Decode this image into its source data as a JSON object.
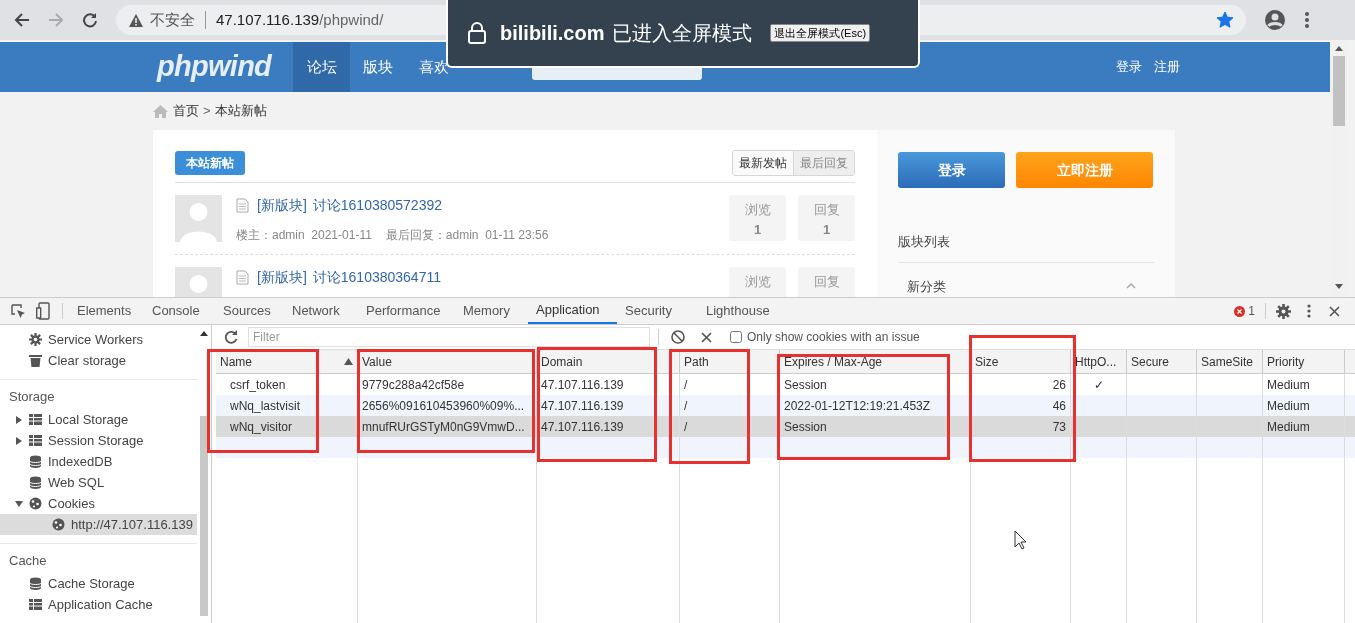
{
  "browser": {
    "security_label": "不安全",
    "url_host": "47.107.116.139",
    "url_path": "/phpwind/",
    "forward_disabled": true,
    "bookmarked": true
  },
  "fullscreen_notice": {
    "site": "bilibili.com",
    "message": "已进入全屏模式",
    "exit_button": "退出全屏模式(Esc)"
  },
  "site": {
    "logo": "phpwind",
    "nav": [
      {
        "label": "论坛",
        "selected": true
      },
      {
        "label": "版块",
        "selected": false
      },
      {
        "label": "喜欢",
        "selected": false
      }
    ],
    "user_links": [
      "登录",
      "注册"
    ],
    "breadcrumb": [
      "首页",
      ">",
      "本站新帖"
    ],
    "list_title": "本站新帖",
    "sort_tabs": [
      {
        "label": "最新发帖",
        "selected": true
      },
      {
        "label": "最后回复",
        "selected": false
      }
    ],
    "posts": [
      {
        "forum": "[新版块]",
        "title": "讨论1610380572392",
        "author": "楼主：admin  2021-01-11",
        "last_reply": "最后回复：admin  01-11 23:56",
        "views_label": "浏览",
        "views": "1",
        "replies_label": "回复",
        "replies": "1"
      },
      {
        "forum": "[新版块]",
        "title": "讨论1610380364711",
        "views_label": "浏览",
        "replies_label": "回复"
      }
    ],
    "login_button": "登录",
    "register_button": "立即注册",
    "forum_list_title": "版块列表",
    "forum_categories": [
      {
        "label": "新分类",
        "expanded": true
      }
    ]
  },
  "devtools": {
    "tabs": [
      {
        "label": "Elements",
        "selected": false
      },
      {
        "label": "Console",
        "selected": false
      },
      {
        "label": "Sources",
        "selected": false
      },
      {
        "label": "Network",
        "selected": false
      },
      {
        "label": "Performance",
        "selected": false
      },
      {
        "label": "Memory",
        "selected": false
      },
      {
        "label": "Application",
        "selected": true
      },
      {
        "label": "Security",
        "selected": false
      },
      {
        "label": "Lighthouse",
        "selected": false
      }
    ],
    "error_count": "1",
    "sidebar": [
      {
        "kind": "item",
        "label": "Service Workers"
      },
      {
        "kind": "item",
        "label": "Clear storage"
      },
      {
        "kind": "header",
        "label": "Storage"
      },
      {
        "kind": "item",
        "label": "Local Storage",
        "expanded": false
      },
      {
        "kind": "item",
        "label": "Session Storage",
        "expanded": false
      },
      {
        "kind": "item",
        "label": "IndexedDB"
      },
      {
        "kind": "item",
        "label": "Web SQL"
      },
      {
        "kind": "item",
        "label": "Cookies",
        "expanded": true,
        "children": [
          {
            "kind": "item",
            "label": "http://47.107.116.139",
            "selected": true
          }
        ]
      },
      {
        "kind": "header",
        "label": "Cache"
      },
      {
        "kind": "item",
        "label": "Cache Storage"
      },
      {
        "kind": "item",
        "label": "Application Cache"
      }
    ],
    "filter": {
      "placeholder": "Filter"
    },
    "only_issues": {
      "label": "Only show cookies with an issue",
      "checked": false
    },
    "columns": [
      "Name",
      "Value",
      "Domain",
      "Path",
      "Expires / Max-Age",
      "Size",
      "HttpO...",
      "Secure",
      "SameSite",
      "Priority"
    ],
    "rows": [
      {
        "selected": false,
        "cells": [
          "csrf_token",
          "9779c288a42cf58e",
          "47.107.116.139",
          "/",
          "Session",
          "26",
          "✓",
          "",
          "",
          "Medium"
        ]
      },
      {
        "selected": false,
        "cells": [
          "wNq_lastvisit",
          "2656%091610453960%09%...",
          "47.107.116.139",
          "/",
          "2022-01-12T12:19:21.453Z",
          "46",
          "",
          "",
          "",
          "Medium"
        ]
      },
      {
        "selected": true,
        "cells": [
          "wNq_visitor",
          "mnufRUrGSTyM0nG9VmwD...",
          "47.107.116.139",
          "/",
          "Session",
          "73",
          "",
          "",
          "",
          "Medium"
        ]
      }
    ]
  }
}
